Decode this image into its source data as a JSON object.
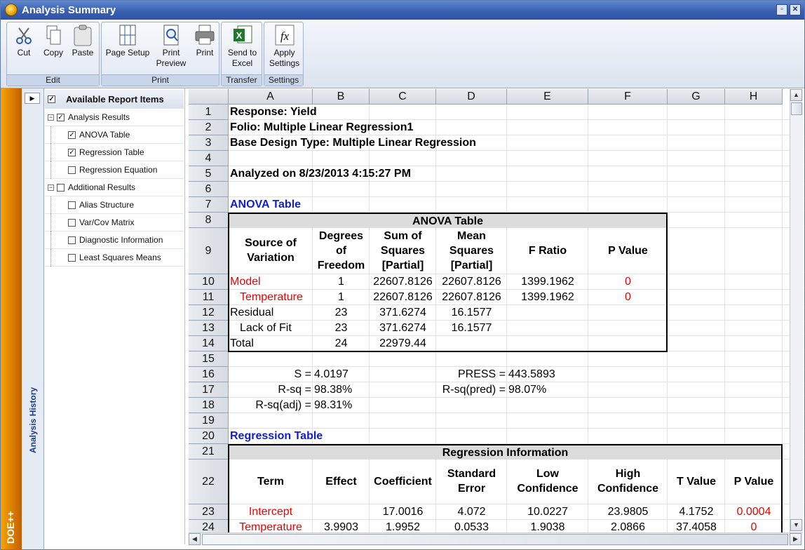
{
  "window": {
    "title": "Analysis Summary"
  },
  "ribbon": {
    "groups": [
      {
        "label": "Edit",
        "buttons": [
          {
            "label": "Cut",
            "icon": "scissors-icon"
          },
          {
            "label": "Copy",
            "icon": "copy-icon"
          },
          {
            "label": "Paste",
            "icon": "paste-icon"
          }
        ]
      },
      {
        "label": "Print",
        "buttons": [
          {
            "label": "Page Setup",
            "icon": "page-setup-icon"
          },
          {
            "label": "Print Preview",
            "icon": "print-preview-icon"
          },
          {
            "label": "Print",
            "icon": "printer-icon"
          }
        ]
      },
      {
        "label": "Transfer",
        "buttons": [
          {
            "label": "Send to Excel",
            "icon": "excel-icon"
          }
        ]
      },
      {
        "label": "Settings",
        "buttons": [
          {
            "label": "Apply Settings",
            "icon": "function-icon"
          }
        ]
      }
    ]
  },
  "sidebar": {
    "brand": "DOE++",
    "history_label": "Analysis History"
  },
  "tree": {
    "header": "Available Report Items",
    "items": [
      {
        "label": "Analysis Results",
        "level": 0,
        "checked": true
      },
      {
        "label": "ANOVA Table",
        "level": 1,
        "checked": true
      },
      {
        "label": "Regression Table",
        "level": 1,
        "checked": true
      },
      {
        "label": "Regression Equation",
        "level": 1,
        "checked": false
      },
      {
        "label": "Additional Results",
        "level": 0,
        "checked": false
      },
      {
        "label": "Alias Structure",
        "level": 1,
        "checked": false
      },
      {
        "label": "Var/Cov Matrix",
        "level": 1,
        "checked": false
      },
      {
        "label": "Diagnostic Information",
        "level": 1,
        "checked": false
      },
      {
        "label": "Least Squares Means",
        "level": 1,
        "checked": false
      }
    ]
  },
  "sheet": {
    "columns": [
      "A",
      "B",
      "C",
      "D",
      "E",
      "F",
      "G",
      "H"
    ],
    "rows": [
      "1",
      "2",
      "3",
      "4",
      "5",
      "6",
      "7",
      "8",
      "9",
      "10",
      "11",
      "12",
      "13",
      "14",
      "15",
      "16",
      "17",
      "18",
      "19",
      "20",
      "21",
      "22",
      "23",
      "24"
    ],
    "response": "Response: Yield",
    "folio": "Folio: Multiple Linear Regression1",
    "design": "Base Design Type: Multiple Linear Regression",
    "analyzed": "Analyzed on 8/23/2013 4:15:27 PM",
    "anova_link": "ANOVA Table",
    "anova": {
      "title": "ANOVA Table",
      "headers": [
        "Source of Variation",
        "Degrees of Freedom",
        "Sum of Squares [Partial]",
        "Mean Squares [Partial]",
        "F Ratio",
        "P Value"
      ],
      "rows": [
        [
          "Model",
          "1",
          "22607.8126",
          "22607.8126",
          "1399.1962",
          "0"
        ],
        [
          "Temperature",
          "1",
          "22607.8126",
          "22607.8126",
          "1399.1962",
          "0"
        ],
        [
          "Residual",
          "23",
          "371.6274",
          "16.1577",
          "",
          ""
        ],
        [
          "Lack of Fit",
          "23",
          "371.6274",
          "16.1577",
          "",
          ""
        ],
        [
          "Total",
          "24",
          "22979.44",
          "",
          "",
          ""
        ]
      ]
    },
    "stats": {
      "s_label": "S =",
      "s_value": "4.0197",
      "rsq_label": "R-sq =",
      "rsq_value": "98.38%",
      "rsqadj_label": "R-sq(adj) =",
      "rsqadj_value": "98.31%",
      "press_label": "PRESS =",
      "press_value": "443.5893",
      "rsqpred_label": "R-sq(pred) =",
      "rsqpred_value": "98.07%"
    },
    "regression_link": "Regression Table",
    "regression": {
      "title": "Regression Information",
      "headers": [
        "Term",
        "Effect",
        "Coefficient",
        "Standard Error",
        "Low Confidence",
        "High Confidence",
        "T Value",
        "P Value"
      ],
      "rows": [
        [
          "Intercept",
          "",
          "17.0016",
          "4.072",
          "10.0227",
          "23.9805",
          "4.1752",
          "0.0004"
        ],
        [
          "Temperature",
          "3.9903",
          "1.9952",
          "0.0533",
          "1.9038",
          "2.0866",
          "37.4058",
          "0"
        ]
      ]
    }
  },
  "colors": {
    "accent": "#3a5fb0",
    "link_blue": "#1020d0",
    "red": "#e00000",
    "brand_orange": "#f6a400"
  }
}
